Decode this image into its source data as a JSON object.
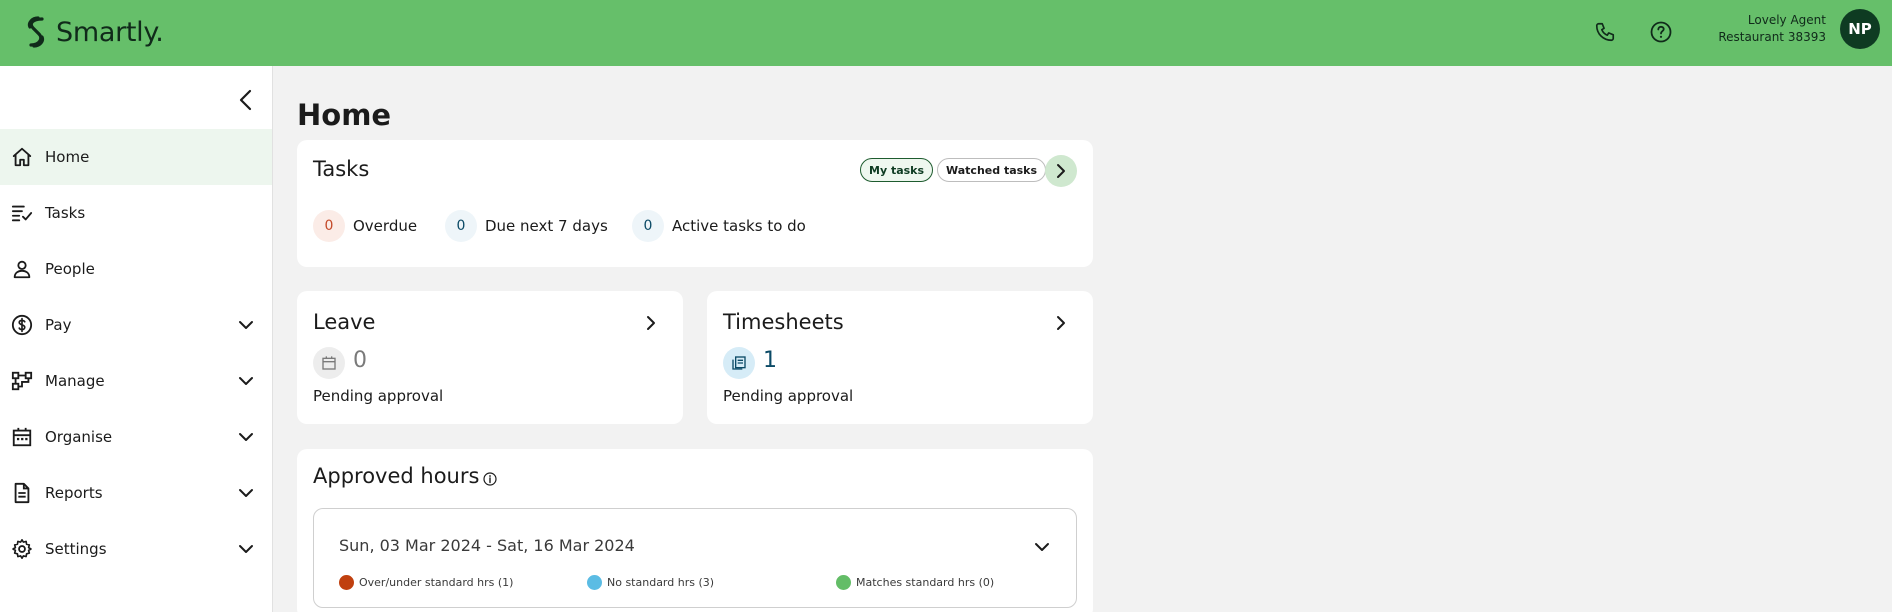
{
  "header": {
    "brand": "Smartly.",
    "user_name": "Lovely Agent",
    "user_org": "Restaurant 38393",
    "avatar_initials": "NP",
    "bg_color": "#66bf6a"
  },
  "sidebar": {
    "items": [
      {
        "label": "Home",
        "icon": "home-icon",
        "active": true
      },
      {
        "label": "Tasks",
        "icon": "tasks-icon"
      },
      {
        "label": "People",
        "icon": "person-icon"
      },
      {
        "label": "Pay",
        "icon": "dollar-icon",
        "expandable": true
      },
      {
        "label": "Manage",
        "icon": "hierarchy-icon",
        "expandable": true
      },
      {
        "label": "Organise",
        "icon": "calendar-icon",
        "expandable": true
      },
      {
        "label": "Reports",
        "icon": "document-icon",
        "expandable": true
      },
      {
        "label": "Settings",
        "icon": "gear-icon",
        "expandable": true
      }
    ]
  },
  "main": {
    "title": "Home",
    "tasks": {
      "title": "Tasks",
      "tab_mine": "My tasks",
      "tab_watched": "Watched tasks",
      "stats": [
        {
          "count": "0",
          "label": "Overdue",
          "color": "#c44a2a",
          "bg": "#fbece7"
        },
        {
          "count": "0",
          "label": "Due next 7 days",
          "color": "#0b4a66",
          "bg": "#eef5f9"
        },
        {
          "count": "0",
          "label": "Active tasks to do",
          "color": "#0b4a66",
          "bg": "#eef5f9"
        }
      ]
    },
    "leave": {
      "title": "Leave",
      "count": "0",
      "label": "Pending approval"
    },
    "timesheets": {
      "title": "Timesheets",
      "count": "1",
      "label": "Pending approval"
    },
    "approved_hours": {
      "title": "Approved hours",
      "date_range": "Sun, 03 Mar 2024 - Sat, 16 Mar 2024",
      "legend": [
        {
          "label": "Over/under standard hrs (1)",
          "color": "#c0400f"
        },
        {
          "label": "No standard hrs (3)",
          "color": "#5bbce4"
        },
        {
          "label": "Matches standard hrs (0)",
          "color": "#63bd67"
        }
      ]
    }
  }
}
